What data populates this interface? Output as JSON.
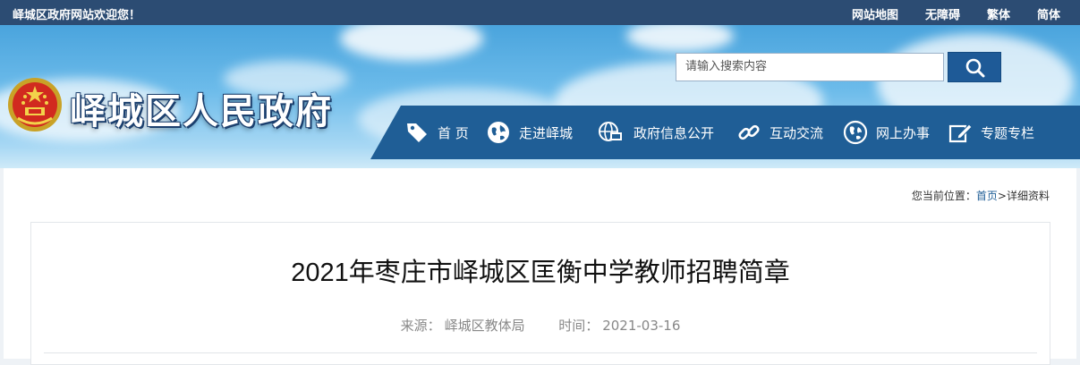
{
  "topbar": {
    "welcome": "峄城区政府网站欢迎您！",
    "links": [
      "网站地图",
      "无障碍",
      "繁体",
      "简体"
    ]
  },
  "header": {
    "site_title": "峄城区人民政府",
    "search_placeholder": "请输入搜索内容"
  },
  "nav": {
    "items": [
      {
        "label": "首 页",
        "icon": "tag-icon"
      },
      {
        "label": "走进峄城",
        "icon": "globe-icon"
      },
      {
        "label": "政府信息公开",
        "icon": "web-globe-icon"
      },
      {
        "label": "互动交流",
        "icon": "link-icon"
      },
      {
        "label": "网上办事",
        "icon": "earth-icon"
      },
      {
        "label": "专题专栏",
        "icon": "edit-icon"
      }
    ]
  },
  "breadcrumb": {
    "prefix": "您当前位置：",
    "home": "首页",
    "separator": ">",
    "current": "详细资料"
  },
  "article": {
    "title": "2021年枣庄市峄城区匡衡中学教师招聘简章",
    "source_label": "来源：",
    "source": "峄城区教体局",
    "time_label": "时间：",
    "time": "2021-03-16"
  },
  "colors": {
    "topbar": "#2c4c73",
    "nav": "#1f5e96",
    "search_button": "#1e5a97"
  }
}
